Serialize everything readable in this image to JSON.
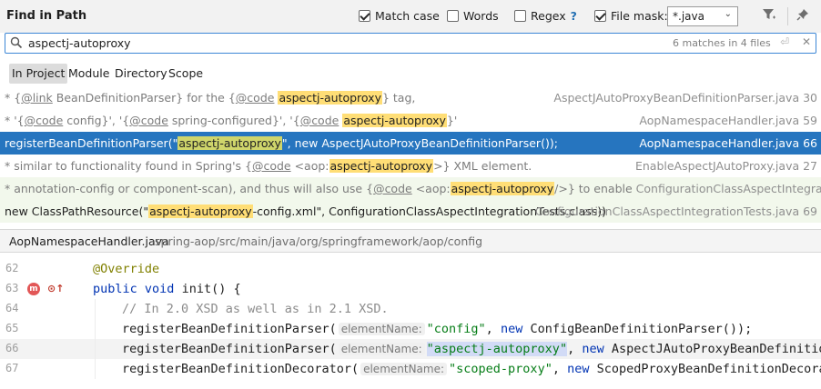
{
  "header": {
    "title": "Find in Path",
    "options": {
      "match_case": {
        "label": "Match case",
        "checked": true
      },
      "words": {
        "label": "Words",
        "checked": false
      },
      "regex": {
        "label": "Regex",
        "help": "?",
        "checked": false
      },
      "file_mask": {
        "label": "File mask:",
        "checked": true,
        "value": "*.java"
      }
    },
    "icons": [
      "filter-icon",
      "pin-icon"
    ]
  },
  "search": {
    "query": "aspectj-autoproxy",
    "match_count": "6 matches in 4 files"
  },
  "scopes": [
    {
      "label": "In Project",
      "active": true
    },
    {
      "label": "Module",
      "active": false
    },
    {
      "label": "Directory",
      "active": false
    },
    {
      "label": "Scope",
      "active": false
    }
  ],
  "results": [
    {
      "p1": "* {",
      "l1": "@link",
      "p2": " BeanDefinitionParser} for the {",
      "l2": "@code",
      "p3": " ",
      "match": "aspectj-autoproxy",
      "p4": "} tag,",
      "file": "AspectJAutoProxyBeanDefinitionParser.java 30"
    },
    {
      "p1": "* '{",
      "l1": "@code",
      "p2": " config}', '{",
      "l2": "@code",
      "p3": " spring-configured}', '{",
      "l3": "@code",
      "p4": " ",
      "match": "aspectj-autoproxy",
      "p5": "}'",
      "file": "AopNamespaceHandler.java 59"
    },
    {
      "p1": "registerBeanDefinitionParser(\"",
      "match": "aspectj-autoproxy",
      "p2": "\", new AspectJAutoProxyBeanDefinitionParser());",
      "file": "AopNamespaceHandler.java 66"
    },
    {
      "p1": "* similar to functionality found in Spring's {",
      "l1": "@code",
      "p2": " <aop:",
      "match": "aspectj-autoproxy",
      "p3": ">} XML element.",
      "file": "EnableAspectJAutoProxy.java 27"
    },
    {
      "p1": "* annotation-config or component-scan), and thus will also use {",
      "l1": "@code",
      "p2": " <aop:",
      "match": "aspectj-autoproxy",
      "p3": "/>} to enable ",
      "file": "ConfigurationClassAspectIntegrationTests.java"
    },
    {
      "p1": "new ClassPathResource(\"",
      "match": "aspectj-autoproxy",
      "p2": "-config.xml\", ConfigurationClassAspectIntegrationTests.class))",
      "file": "ConfigurationClassAspectIntegrationTests.java 69"
    }
  ],
  "preview": {
    "file": "AopNamespaceHandler.java",
    "path": "spring-aop/src/main/java/org/springframework/aop/config"
  },
  "editor": {
    "l62": {
      "num": "62",
      "ann": "@Override"
    },
    "l63": {
      "num": "63",
      "kw1": "public",
      "kw2": "void",
      "rest": " init() {",
      "gutter1": "m",
      "gutter2": "⊙↑"
    },
    "l64": {
      "num": "64",
      "comment": "// In 2.0 XSD as well as in 2.1 XSD."
    },
    "l65": {
      "num": "65",
      "call": "registerBeanDefinitionParser(",
      "hint": "elementName:",
      "str": "\"config\"",
      "sep": ", ",
      "kw": "new",
      "rest": " ConfigBeanDefinitionParser());"
    },
    "l66": {
      "num": "66",
      "call": "registerBeanDefinitionParser(",
      "hint": "elementName:",
      "str": "\"aspectj-autoproxy\"",
      "sep": ", ",
      "kw": "new",
      "rest": " AspectJAutoProxyBeanDefinitio"
    },
    "l67": {
      "num": "67",
      "call": "registerBeanDefinitionDecorator(",
      "hint": "elementName:",
      "str": "\"scoped-proxy\"",
      "sep": ", ",
      "kw": "new",
      "rest": " ScopedProxyBeanDefinitionDecora"
    }
  }
}
